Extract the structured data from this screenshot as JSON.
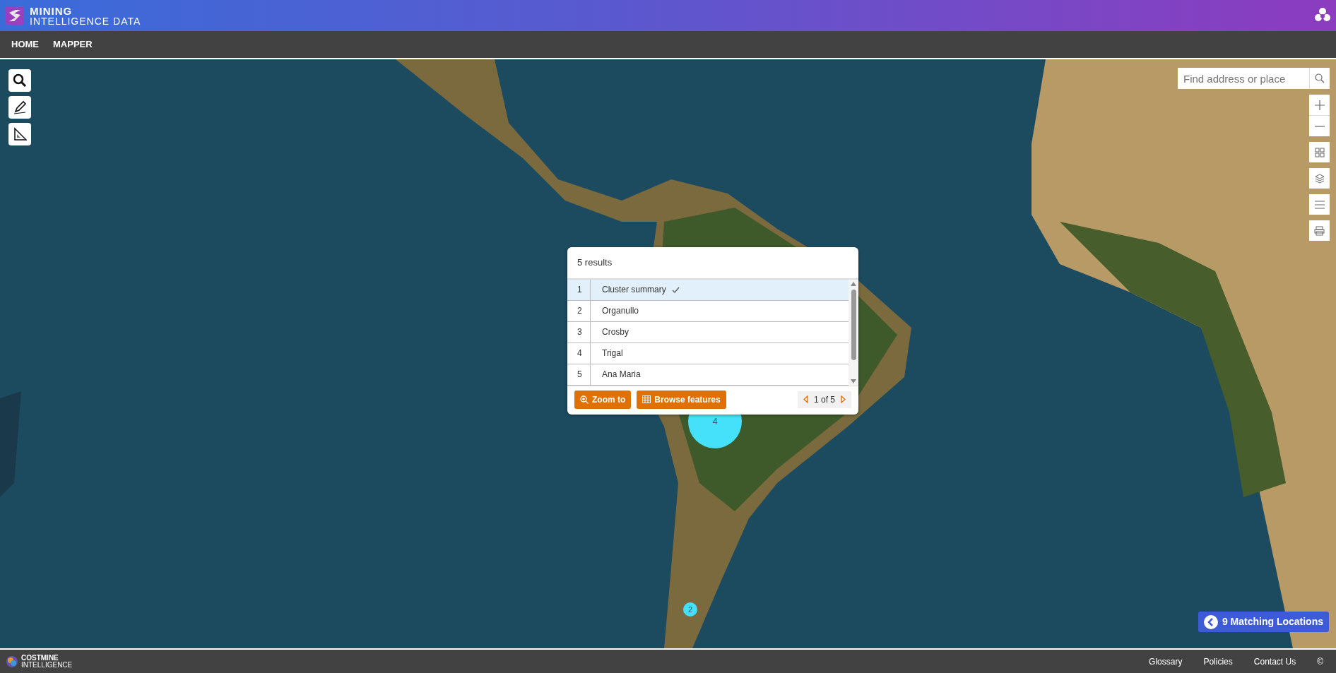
{
  "header": {
    "logo_line1": "MINING",
    "logo_line2": "INTELLIGENCE DATA"
  },
  "nav": [
    {
      "label": "HOME"
    },
    {
      "label": "MAPPER"
    }
  ],
  "map": {
    "search": {
      "placeholder": "Find address or place"
    },
    "clusters": [
      {
        "count": "4"
      },
      {
        "count": "2"
      }
    ],
    "matching_button": "9 Matching Locations"
  },
  "popup": {
    "title": "5 results",
    "rows": [
      {
        "index": "1",
        "label": "Cluster summary",
        "selected": true
      },
      {
        "index": "2",
        "label": "Organullo",
        "selected": false
      },
      {
        "index": "3",
        "label": "Crosby",
        "selected": false
      },
      {
        "index": "4",
        "label": "Trigal",
        "selected": false
      },
      {
        "index": "5",
        "label": "Ana Maria",
        "selected": false
      }
    ],
    "buttons": [
      {
        "kind": "zoom",
        "label": "Zoom to"
      },
      {
        "kind": "browse",
        "label": "Browse features"
      }
    ],
    "pager": "1 of 5"
  },
  "footer": {
    "brand_line1": "COSTMINE",
    "brand_line2": "INTELLIGENCE",
    "links": [
      "Glossary",
      "Policies",
      "Contact Us",
      "©"
    ]
  }
}
